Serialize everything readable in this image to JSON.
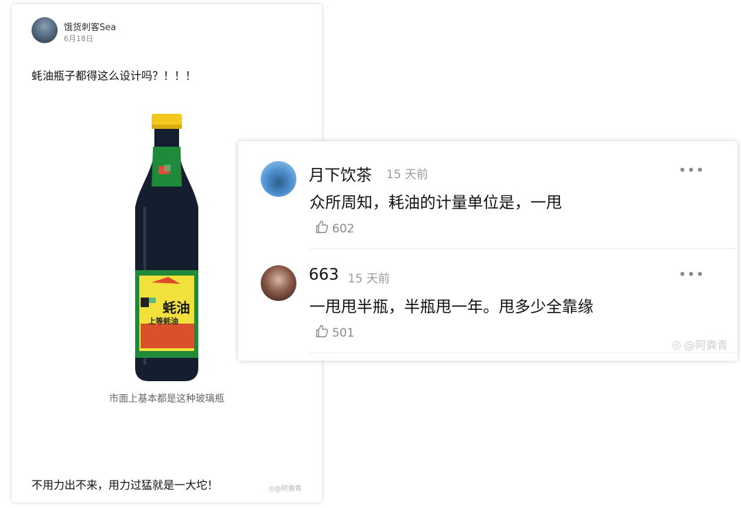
{
  "post": {
    "author": "饿货刺客Sea",
    "date": "6月18日",
    "title": "蚝油瓶子都得这么设计吗？！！！",
    "label_main": "蚝油",
    "label_sub": "上等蚝油",
    "caption": "市面上基本都是这种玻璃瓶",
    "footer": "不用力出不来，用力过猛就是一大坨！",
    "watermark": "@阿粪青"
  },
  "comments": [
    {
      "name": "月下饮茶",
      "time": "15 天前",
      "text": "众所周知，耗油的计量单位是，一甩",
      "likes": "602",
      "more": "•••"
    },
    {
      "name": "663",
      "time": "15 天前",
      "text": "一甩甩半瓶，半瓶甩一年。甩多少全靠缘",
      "likes": "501",
      "more": "•••"
    }
  ],
  "watermark": "@阿粪青",
  "colors": {
    "background": "#ffffff",
    "bottle_green": "#1f8a3a",
    "cap_yellow": "#f2c81f",
    "label_yellow": "#f3e13b"
  }
}
